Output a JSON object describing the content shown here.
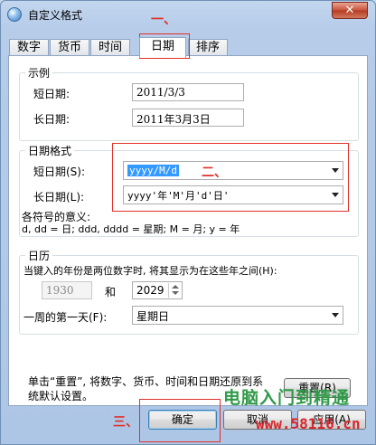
{
  "window": {
    "title": "自定义格式",
    "close_glyph": "✕"
  },
  "tabs": [
    {
      "label": "数字"
    },
    {
      "label": "货币"
    },
    {
      "label": "时间"
    },
    {
      "label": "日期"
    },
    {
      "label": "排序"
    }
  ],
  "example": {
    "title": "示例",
    "short_label": "短日期:",
    "short_value": "2011/3/3",
    "long_label": "长日期:",
    "long_value": "2011年3月3日"
  },
  "format": {
    "title": "日期格式",
    "short_label": "短日期(S):",
    "short_value": "yyyy/M/d",
    "long_label": "长日期(L):",
    "long_value": "yyyy'年'M'月'd'日'",
    "symbols_title": "各符号的意义:",
    "symbols_text": "d, dd = 日;  ddd, dddd = 星期;  M = 月;  y = 年"
  },
  "calendar": {
    "title": "日历",
    "twodigit_text": "当键入的年份是两位数字时, 将其显示为在这些年之间(H):",
    "from_year": "1930",
    "and_text": "和",
    "to_year": "2029",
    "firstday_label": "一周的第一天(F):",
    "firstday_value": "星期日"
  },
  "footer": {
    "reset_text_line1": "单击“重置”, 将数字、货币、时间和日期还原到系",
    "reset_text_line2": "统默认设置。",
    "reset_button": "重置(R)",
    "ok_button": "确定",
    "cancel_button": "取消",
    "apply_button": "应用(A)"
  },
  "annotations": {
    "step1": "一、",
    "step2": "二、",
    "step3": "三、",
    "color": "#e0302a"
  },
  "watermark": {
    "name": "电脑入门到精通",
    "url": "www.58116.cn"
  }
}
